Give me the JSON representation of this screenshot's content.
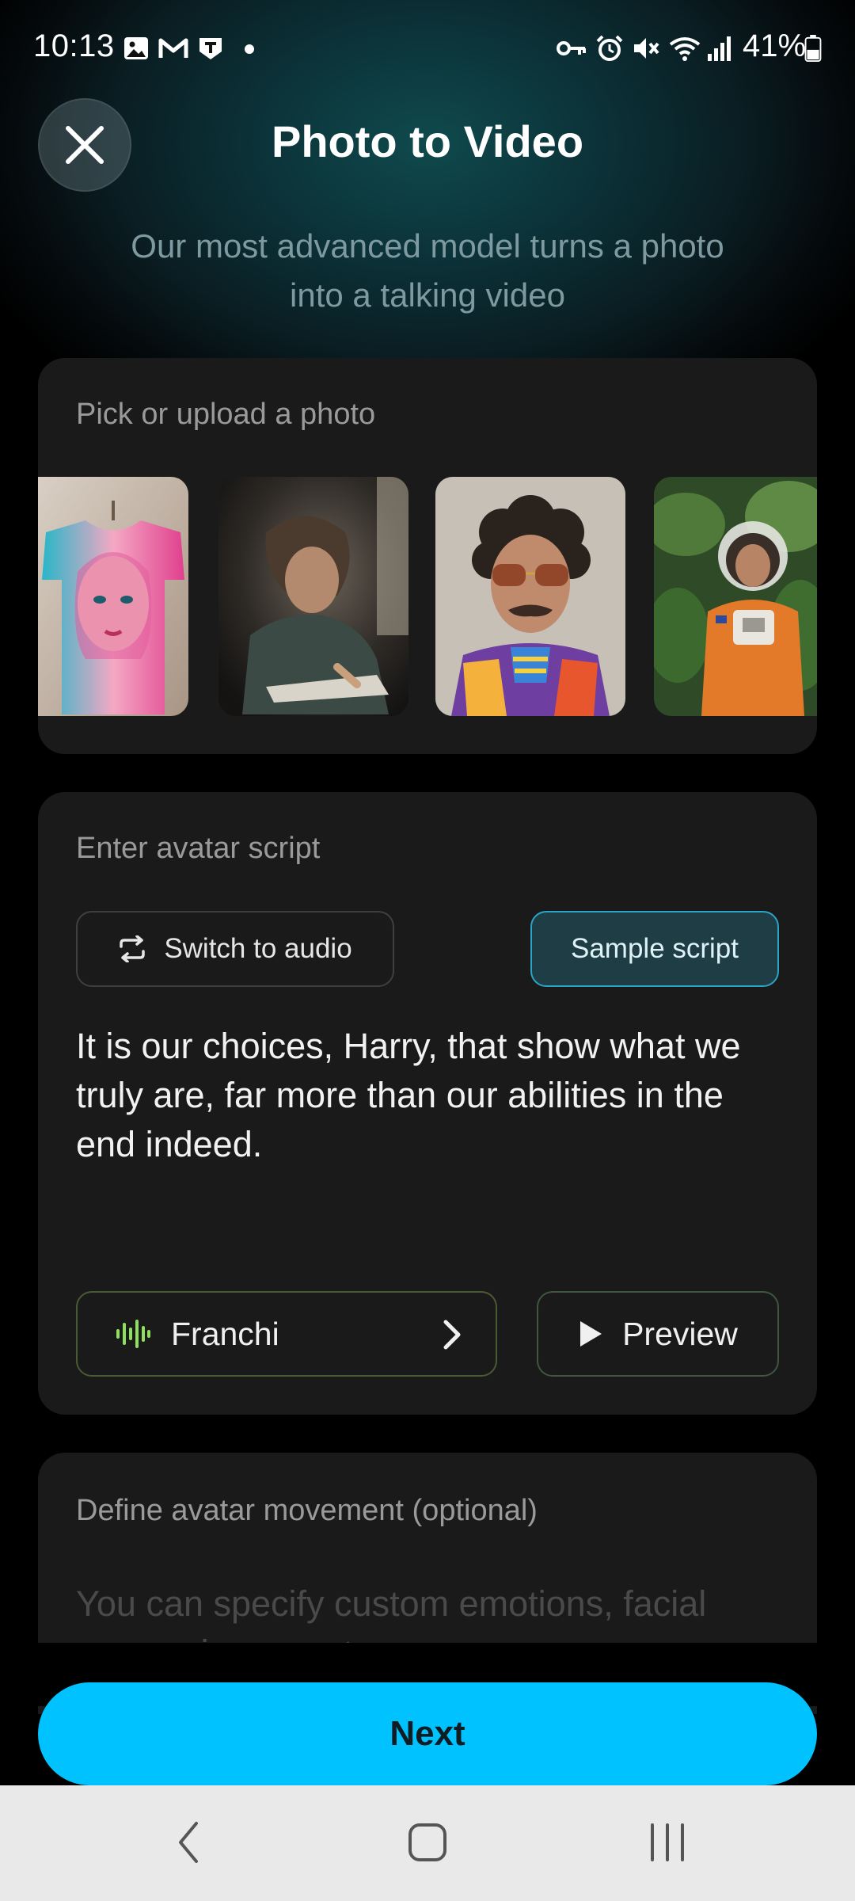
{
  "status_bar": {
    "time": "10:13",
    "battery": "41%",
    "icons": [
      "gallery-icon",
      "gmail-icon",
      "app-notification-icon",
      "dot-icon",
      "vpn-key-icon",
      "alarm-icon",
      "mute-icon",
      "wifi-icon",
      "signal-icon",
      "battery-icon"
    ]
  },
  "header": {
    "title": "Photo to Video",
    "subtitle": "Our most advanced model turns a photo into a talking video"
  },
  "photo_section": {
    "label": "Pick or upload a photo",
    "photos": [
      "painted-face-tshirt-photo",
      "man-writing-photo",
      "curly-hair-sunglasses-man-photo",
      "astronaut-jungle-photo"
    ]
  },
  "script_section": {
    "label": "Enter avatar script",
    "switch_audio_label": "Switch to audio",
    "sample_script_label": "Sample script",
    "script_text": "It is our choices, Harry, that show what we truly are, far more than our abilities in the end indeed.",
    "voice_name": "Franchi",
    "preview_label": "Preview"
  },
  "movement_section": {
    "label": "Define avatar movement (optional)",
    "placeholder": "You can specify custom emotions, facial expressions, gestures, or persona"
  },
  "next_label": "Next",
  "colors": {
    "accent": "#00c2ff",
    "voice_icon": "#8ee05a",
    "card_bg": "#1a1a1a",
    "sample_border": "#2aa5c8"
  }
}
